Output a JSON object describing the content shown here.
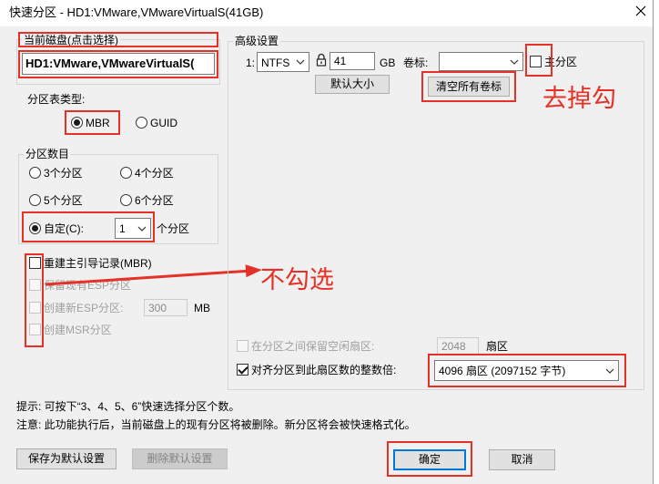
{
  "window": {
    "title": "快速分区 - HD1:VMware,VMwareVirtualS(41GB)"
  },
  "current_disk": {
    "label": "当前磁盘(点击选择)",
    "value": "HD1:VMware,VMwareVirtualS("
  },
  "partition_table": {
    "label": "分区表类型:",
    "options": [
      {
        "label": "MBR",
        "selected": true
      },
      {
        "label": "GUID",
        "selected": false
      }
    ]
  },
  "partition_count": {
    "label": "分区数目",
    "options": [
      {
        "label": "3个分区",
        "selected": false
      },
      {
        "label": "4个分区",
        "selected": false
      },
      {
        "label": "5个分区",
        "selected": false
      },
      {
        "label": "6个分区",
        "selected": false
      }
    ],
    "custom": {
      "label": "自定(C):",
      "selected": true,
      "value": "1",
      "suffix": "个分区"
    }
  },
  "boot_options": [
    {
      "label": "重建主引导记录(MBR)",
      "checked": false,
      "disabled": false
    },
    {
      "label": "保留现有ESP分区",
      "checked": false,
      "disabled": true
    },
    {
      "label": "创建新ESP分区:",
      "checked": false,
      "disabled": true,
      "size": "300",
      "unit": "MB"
    },
    {
      "label": "创建MSR分区",
      "checked": false,
      "disabled": true
    }
  ],
  "advanced": {
    "label": "高级设置",
    "partition": {
      "index": "1:",
      "file_system": "NTFS",
      "size": "41",
      "unit": "GB",
      "volume_label_caption": "卷标:",
      "volume_label": "",
      "primary": {
        "label": "主分区",
        "checked": false
      }
    },
    "default_size_button": "默认大小",
    "clear_labels_button": "清空所有卷标",
    "reserve_free_sectors": {
      "label": "在分区之间保留空闲扇区:",
      "checked": false,
      "disabled": true,
      "value": "2048",
      "unit": "扇区"
    },
    "align": {
      "label": "对齐分区到此扇区数的整数倍:",
      "checked": true,
      "value": "4096 扇区 (2097152 字节)"
    }
  },
  "notes": {
    "hint": "提示: 可按下“3、4、5、6”快速选择分区个数。",
    "warning": "注意: 此功能执行后，当前磁盘上的现有分区将被删除。新分区将会被快速格式化。"
  },
  "buttons": {
    "save_default": {
      "label": "保存为默认设置"
    },
    "delete_default": {
      "label": "删除默认设置",
      "disabled": true
    },
    "ok": {
      "label": "确定"
    },
    "cancel": {
      "label": "取消"
    }
  },
  "annotations": {
    "remove_check": "去掉勾",
    "do_not_check": "不勾选"
  },
  "icons": {
    "close": "close-icon",
    "lock": "lock-icon",
    "dropdown": "chevron-down-icon",
    "arrow": "annotation-arrow-icon"
  },
  "colors": {
    "annotation_red": "#e53228",
    "dialog_background": "#f0f0f0",
    "default_button_border": "#0078d7"
  }
}
